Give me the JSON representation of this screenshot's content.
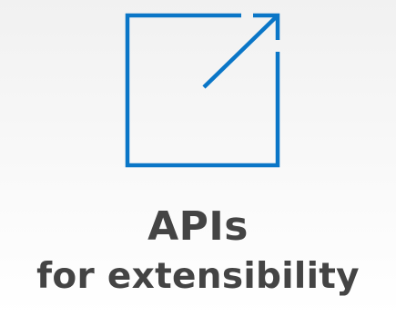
{
  "tile": {
    "icon": "external-link-icon",
    "accent_color": "#0a76c7",
    "text_color": "#444444",
    "title_line1": "APIs",
    "title_line2": "for extensibility"
  }
}
